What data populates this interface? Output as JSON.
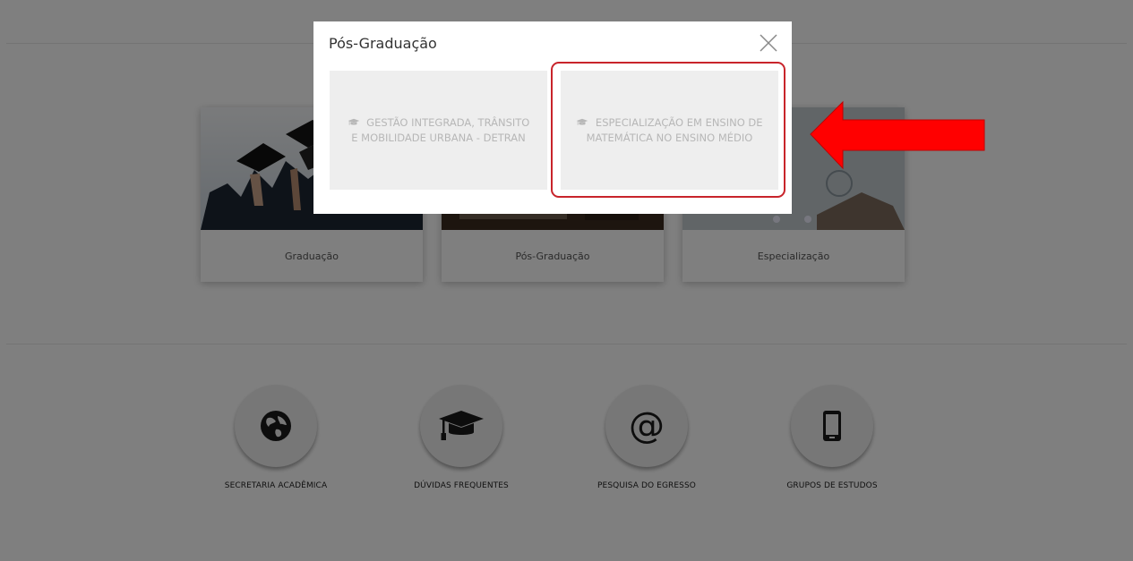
{
  "cards": [
    {
      "label": "Graduação"
    },
    {
      "label": "Pós-Graduação"
    },
    {
      "label": "Especialização"
    }
  ],
  "services": [
    {
      "label": "SECRETARIA ACADÊMICA",
      "icon": "globe-icon"
    },
    {
      "label": "DÚVIDAS FREQUENTES",
      "icon": "graduation-cap-icon"
    },
    {
      "label": "PESQUISA DO EGRESSO",
      "icon": "at-icon",
      "glyph": "@"
    },
    {
      "label": "GRUPOS DE ESTUDOS",
      "icon": "mobile-phone-icon"
    }
  ],
  "modal": {
    "title": "Pós-Graduação",
    "options": [
      {
        "line1": "GESTÃO INTEGRADA, TRÂNSITO",
        "line2": "E MOBILIDADE URBANA - DETRAN",
        "icon": "graduation-cap-icon"
      },
      {
        "line1": "ESPECIALIZAÇÃO EM ENSINO DE",
        "line2": "MATEMÁTICA NO ENSINO MÉDIO",
        "icon": "graduation-cap-icon"
      }
    ]
  },
  "colors": {
    "overlay": "#000000",
    "highlight": "#c8242b",
    "arrow": "#ff0000"
  }
}
